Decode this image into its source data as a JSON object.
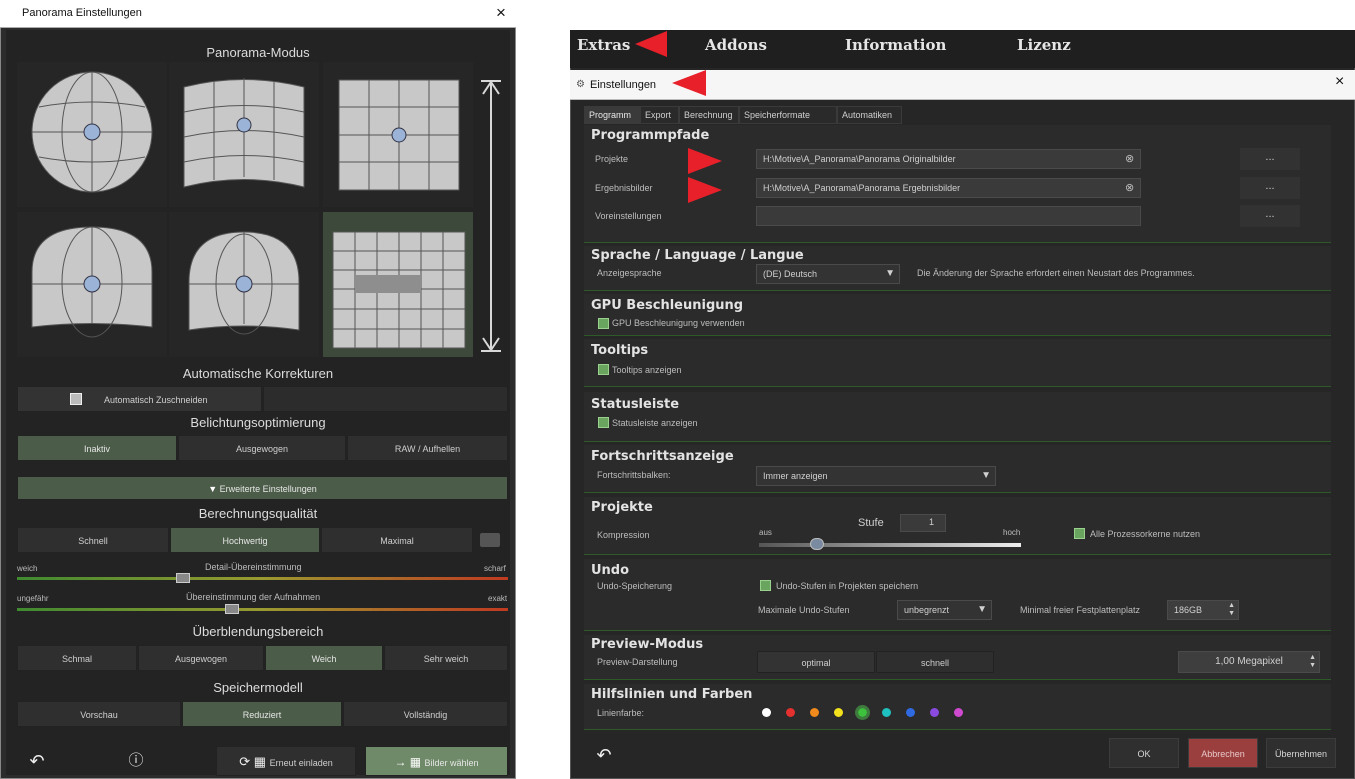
{
  "left": {
    "title": "Panorama Einstellungen",
    "close": "×",
    "panorama_mode": "Panorama-Modus",
    "auto_corrections": "Automatische Korrekturen",
    "auto_crop": "Automatisch Zuschneiden",
    "exposure": "Belichtungsoptimierung",
    "exposure_opts": [
      "Inaktiv",
      "Ausgewogen",
      "RAW / Aufhellen"
    ],
    "advanced": "Erweiterte Einstellungen",
    "quality": "Berechnungsqualität",
    "quality_opts": [
      "Schnell",
      "Hochwertig",
      "Maximal"
    ],
    "detail_label": "Detail-Übereinstimmung",
    "detail_min": "weich",
    "detail_max": "scharf",
    "match_label": "Übereinstimmung der Aufnahmen",
    "match_min": "ungefähr",
    "match_max": "exakt",
    "blend": "Überblendungsbereich",
    "blend_opts": [
      "Schmal",
      "Ausgewogen",
      "Weich",
      "Sehr weich"
    ],
    "memory": "Speichermodell",
    "memory_opts": [
      "Vorschau",
      "Reduziert",
      "Vollständig"
    ],
    "reload": "Erneut einladen",
    "select_images": "Bilder wählen"
  },
  "right": {
    "menu": [
      "Extras",
      "Addons",
      "Information",
      "Lizenz"
    ],
    "dialog_title": "Einstellungen",
    "dialog_close": "×",
    "tabs": [
      "Programm",
      "Export",
      "Berechnung",
      "Speicherformate",
      "Automatiken"
    ],
    "paths": {
      "title": "Programmpfade",
      "projects_label": "Projekte",
      "projects_value": "H:\\Motive\\A_Panorama\\Panorama Originalbilder",
      "results_label": "Ergebnisbilder",
      "results_value": "H:\\Motive\\A_Panorama\\Panorama Ergebnisbilder",
      "presets_label": "Voreinstellungen",
      "browse": "..."
    },
    "language": {
      "title": "Sprache / Language / Langue",
      "label": "Anzeigesprache",
      "value": "(DE) Deutsch",
      "note": "Die Änderung der Sprache erfordert einen Neustart des Programmes."
    },
    "gpu": {
      "title": "GPU Beschleunigung",
      "check": "GPU Beschleunigung verwenden"
    },
    "tooltips": {
      "title": "Tooltips",
      "check": "Tooltips anzeigen"
    },
    "status": {
      "title": "Statusleiste",
      "check": "Statusleiste anzeigen"
    },
    "progress": {
      "title": "Fortschrittsanzeige",
      "label": "Fortschrittsbalken:",
      "value": "Immer anzeigen"
    },
    "projects": {
      "title": "Projekte",
      "label": "Kompression",
      "low": "aus",
      "high": "hoch",
      "level_label": "Stufe",
      "level": "1",
      "cores": "Alle Prozessorkerne nutzen"
    },
    "undo": {
      "title": "Undo",
      "label": "Undo-Speicherung",
      "check": "Undo-Stufen in Projekten speichern",
      "max_label": "Maximale Undo-Stufen",
      "max_value": "unbegrenzt",
      "disk_label": "Minimal freier Festplattenplatz",
      "disk_value": "186GB"
    },
    "preview": {
      "title": "Preview-Modus",
      "label": "Preview-Darstellung",
      "opts": [
        "optimal",
        "schnell"
      ],
      "mp": "1,00 Megapixel"
    },
    "guides": {
      "title": "Hilfslinien und Farben",
      "label": "Linienfarbe:",
      "colors": [
        "#ffffff",
        "#e53030",
        "#f08a1c",
        "#f2e11c",
        "#3ec23e",
        "#1fc0c0",
        "#2f6ae0",
        "#8a4ae0",
        "#d04ad0"
      ]
    },
    "ok": "OK",
    "cancel": "Abbrechen",
    "apply": "Übernehmen"
  }
}
